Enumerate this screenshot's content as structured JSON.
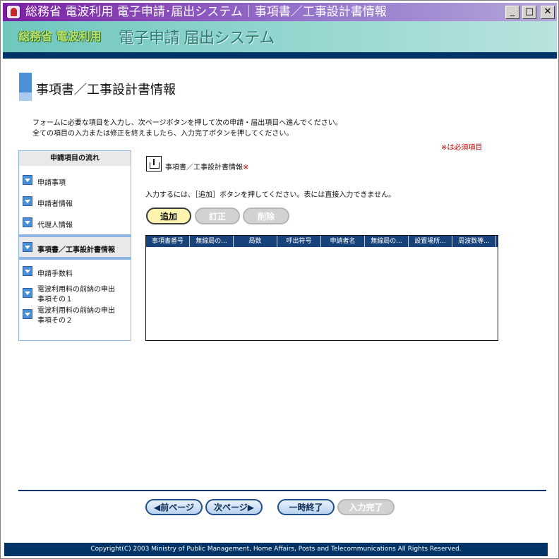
{
  "window": {
    "title": "総務省 電波利用 電子申請･届出システム｜事項書／工事設計書情報",
    "controls": {
      "minimize": "_",
      "maximize": "□",
      "close": "✕"
    }
  },
  "banner": {
    "logo": "総務省 電波利用",
    "system": "電子申請 届出システム"
  },
  "page": {
    "title": "事項書／工事設計書情報",
    "instructions": [
      "フォームに必要な項目を入力し、次ページボタンを押して次の申請・届出項目へ進んでください。",
      "全ての項目の入力または修正を終えましたら、入力完了ボタンを押してください。"
    ],
    "required_note": "※は必須項目"
  },
  "flow": {
    "heading": "申請項目の流れ",
    "items": [
      {
        "label": "申請事項"
      },
      {
        "label": "申請者情報"
      },
      {
        "label": "代理人情報"
      },
      {
        "label": "事項書／工事設計書情報",
        "active": true
      },
      {
        "label": "申請手数料"
      },
      {
        "label": "電波利用料の前納の申出",
        "label2": "事項その１"
      },
      {
        "label": "電波利用料の前納の申出",
        "label2": "事項その２"
      }
    ]
  },
  "section": {
    "title": "事項書／工事設計書情報",
    "required_mark": "※",
    "instruction": "入力するには、［追加］ボタンを押してください。表には直接入力できません。"
  },
  "actions": {
    "add": "追加",
    "edit": "訂正",
    "delete": "削除"
  },
  "table": {
    "columns": [
      "事項書番号",
      "無線局の...",
      "局数",
      "呼出符号",
      "申請者名",
      "無線局の...",
      "設置場所...",
      "周波数等..."
    ],
    "rows": []
  },
  "nav": {
    "prev": "◀前ページ",
    "next": "次ページ▶",
    "pause": "一時終了",
    "complete": "入力完了"
  },
  "footer": {
    "copyright": "Copyright(C) 2003 Ministry of Public Management, Home Affairs, Posts and Telecommunications All Rights Reserved."
  }
}
